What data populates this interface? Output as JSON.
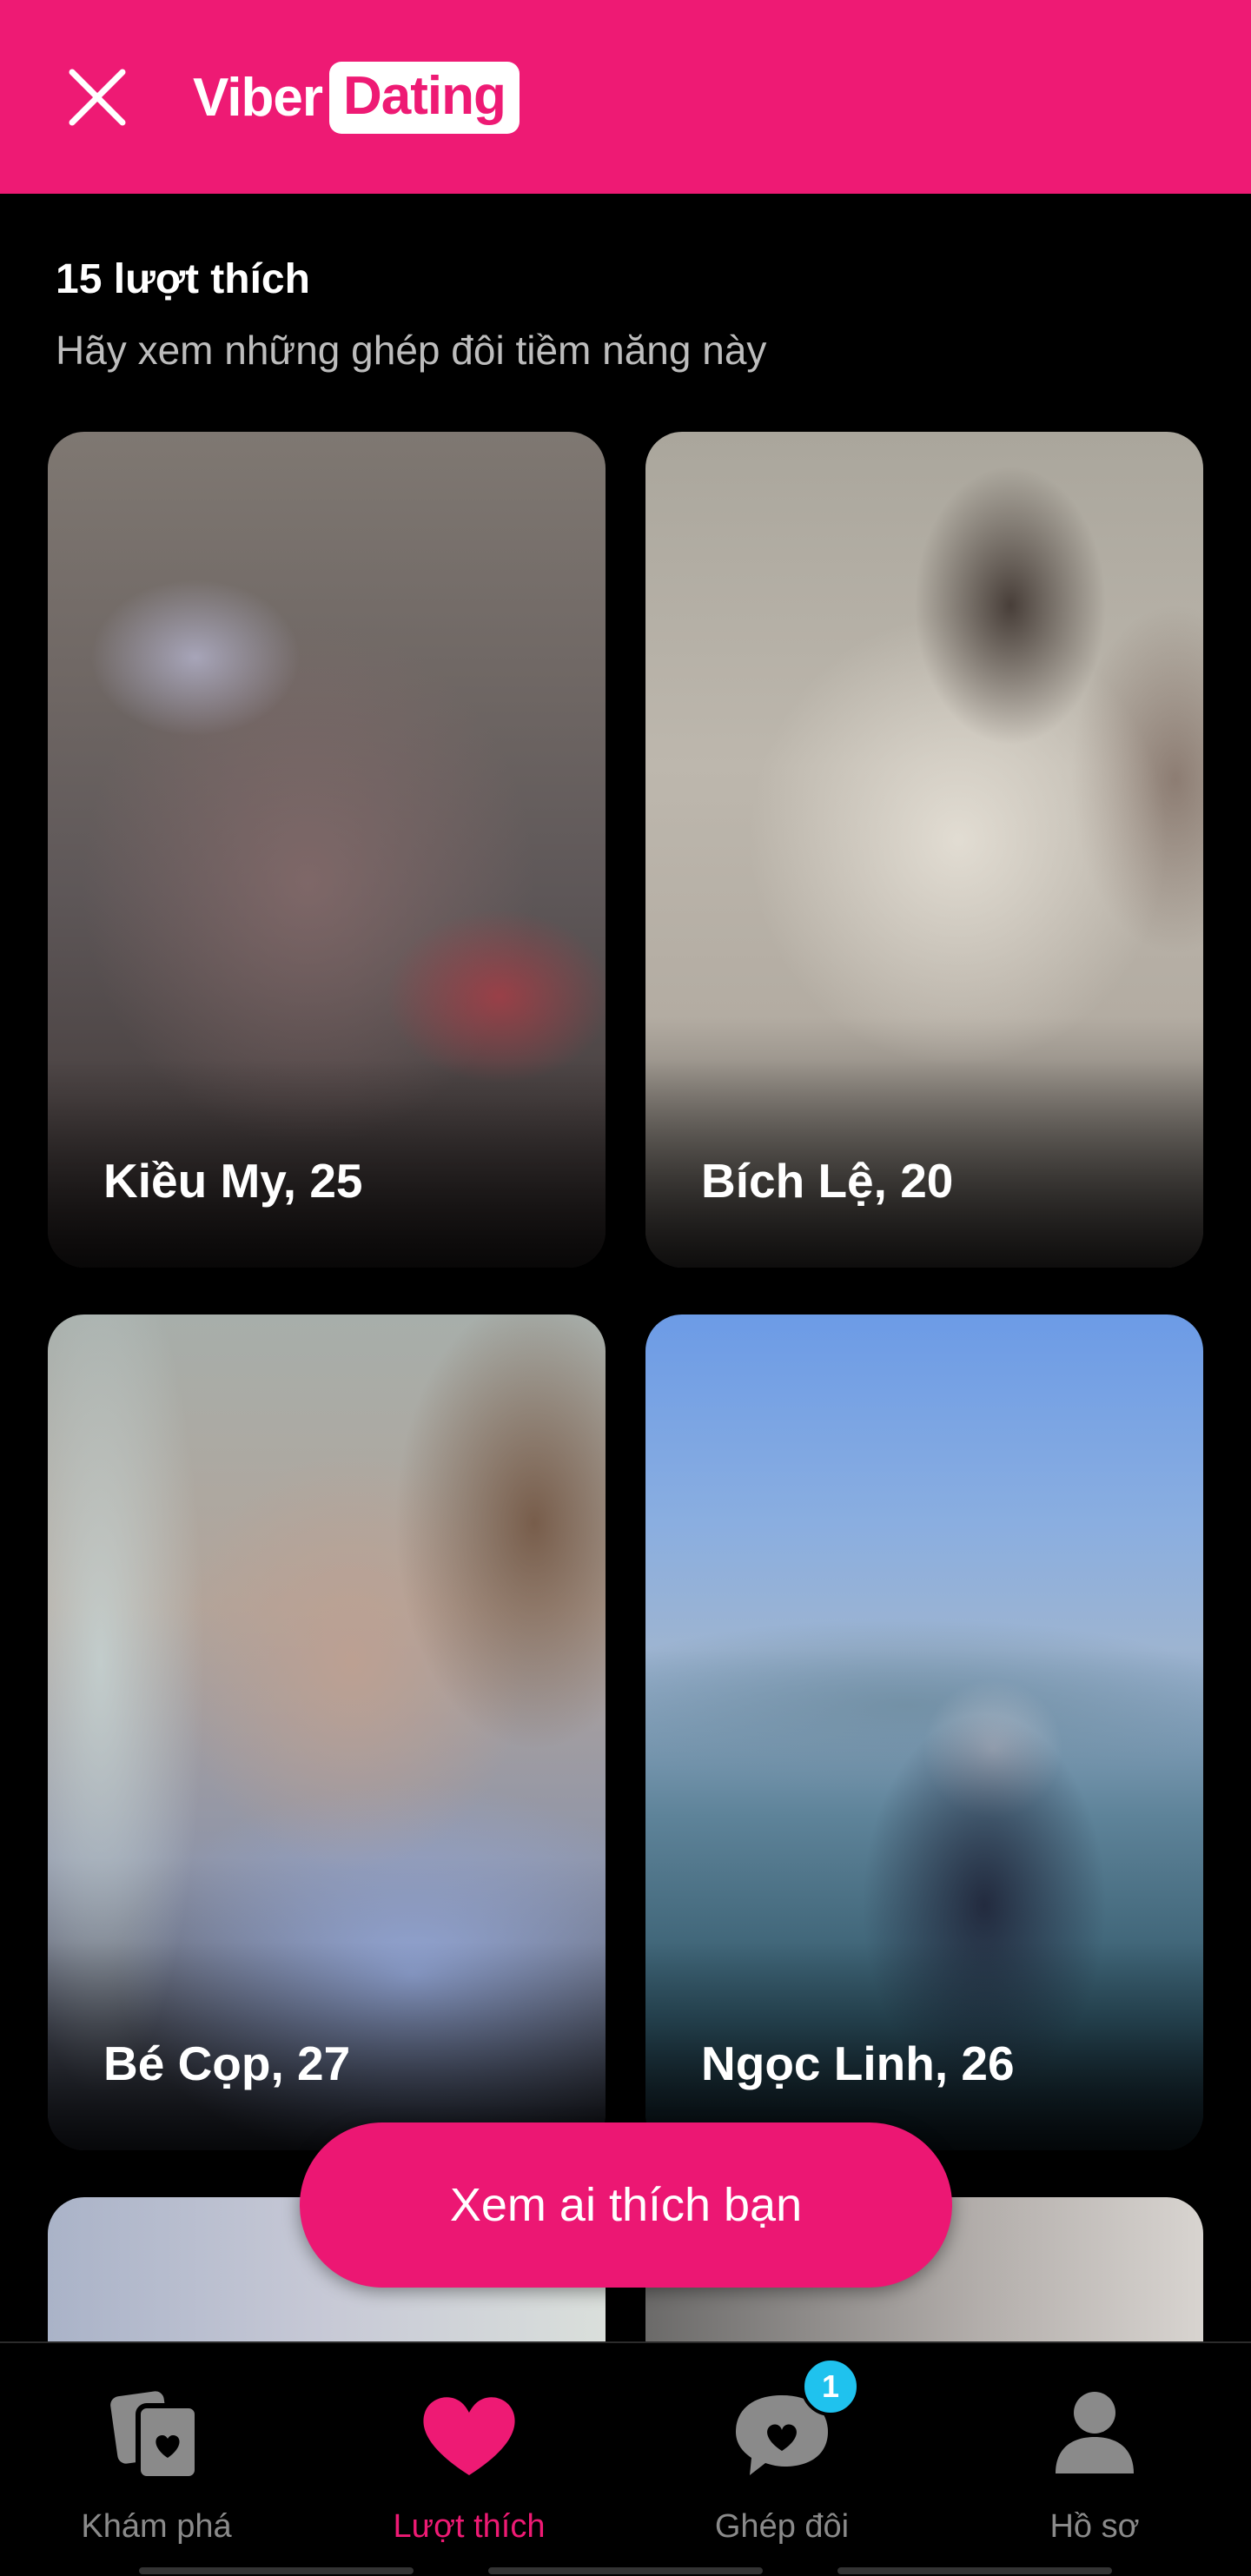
{
  "header": {
    "brand_viber": "Viber",
    "brand_dating": "Dating",
    "color": "#ee1a74"
  },
  "intro": {
    "likes_count": "15 lượt thích",
    "subtitle": "Hãy xem những ghép đôi tiềm năng này"
  },
  "cards": [
    {
      "name": "Kiều My, 25"
    },
    {
      "name": "Bích Lệ, 20"
    },
    {
      "name": "Bé Cọp, 27"
    },
    {
      "name": "Ngọc Linh, 26"
    }
  ],
  "cta": {
    "label": "Xem ai thích bạn"
  },
  "nav": {
    "items": [
      {
        "label": "Khám phá",
        "icon": "discover-cards-icon"
      },
      {
        "label": "Lượt thích",
        "icon": "heart-icon",
        "active": true
      },
      {
        "label": "Ghép đôi",
        "icon": "chat-heart-icon",
        "badge": "1"
      },
      {
        "label": "Hồ sơ",
        "icon": "profile-icon"
      }
    ],
    "active_color": "#ee1a74",
    "badge_color": "#1fc2ee"
  }
}
